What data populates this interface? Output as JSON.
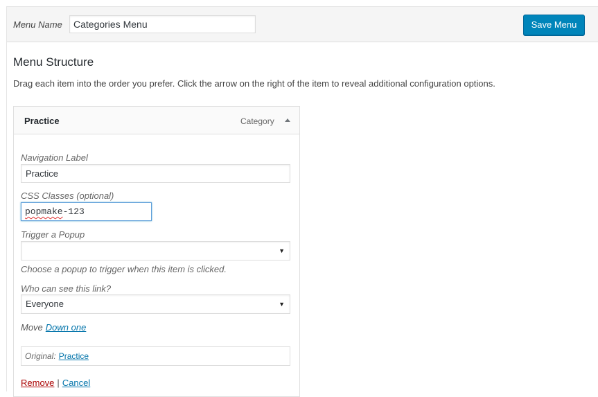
{
  "header": {
    "menu_name_label": "Menu Name",
    "menu_name_value": "Categories Menu",
    "save_button_label": "Save Menu"
  },
  "structure": {
    "title": "Menu Structure",
    "instructions": "Drag each item into the order you prefer. Click the arrow on the right of the item to reveal additional configuration options."
  },
  "item": {
    "title": "Practice",
    "type": "Category",
    "navigation_label_label": "Navigation Label",
    "navigation_label_value": "Practice",
    "css_classes_label": "CSS Classes (optional)",
    "css_classes_value_misspelled": "popmake",
    "css_classes_value_rest": "-123",
    "trigger_popup_label": "Trigger a Popup",
    "trigger_popup_value": "",
    "trigger_popup_hint": "Choose a popup to trigger when this item is clicked.",
    "visibility_label": "Who can see this link?",
    "visibility_value": "Everyone",
    "move_label": "Move",
    "move_down_label": "Down one",
    "original_label": "Original:",
    "original_link": "Practice",
    "remove_label": "Remove",
    "separator": "|",
    "cancel_label": "Cancel"
  },
  "colors": {
    "primary_button": "#0085ba",
    "link": "#0073aa",
    "remove_link": "#aa0000",
    "focus_border": "#5b9dd9"
  }
}
